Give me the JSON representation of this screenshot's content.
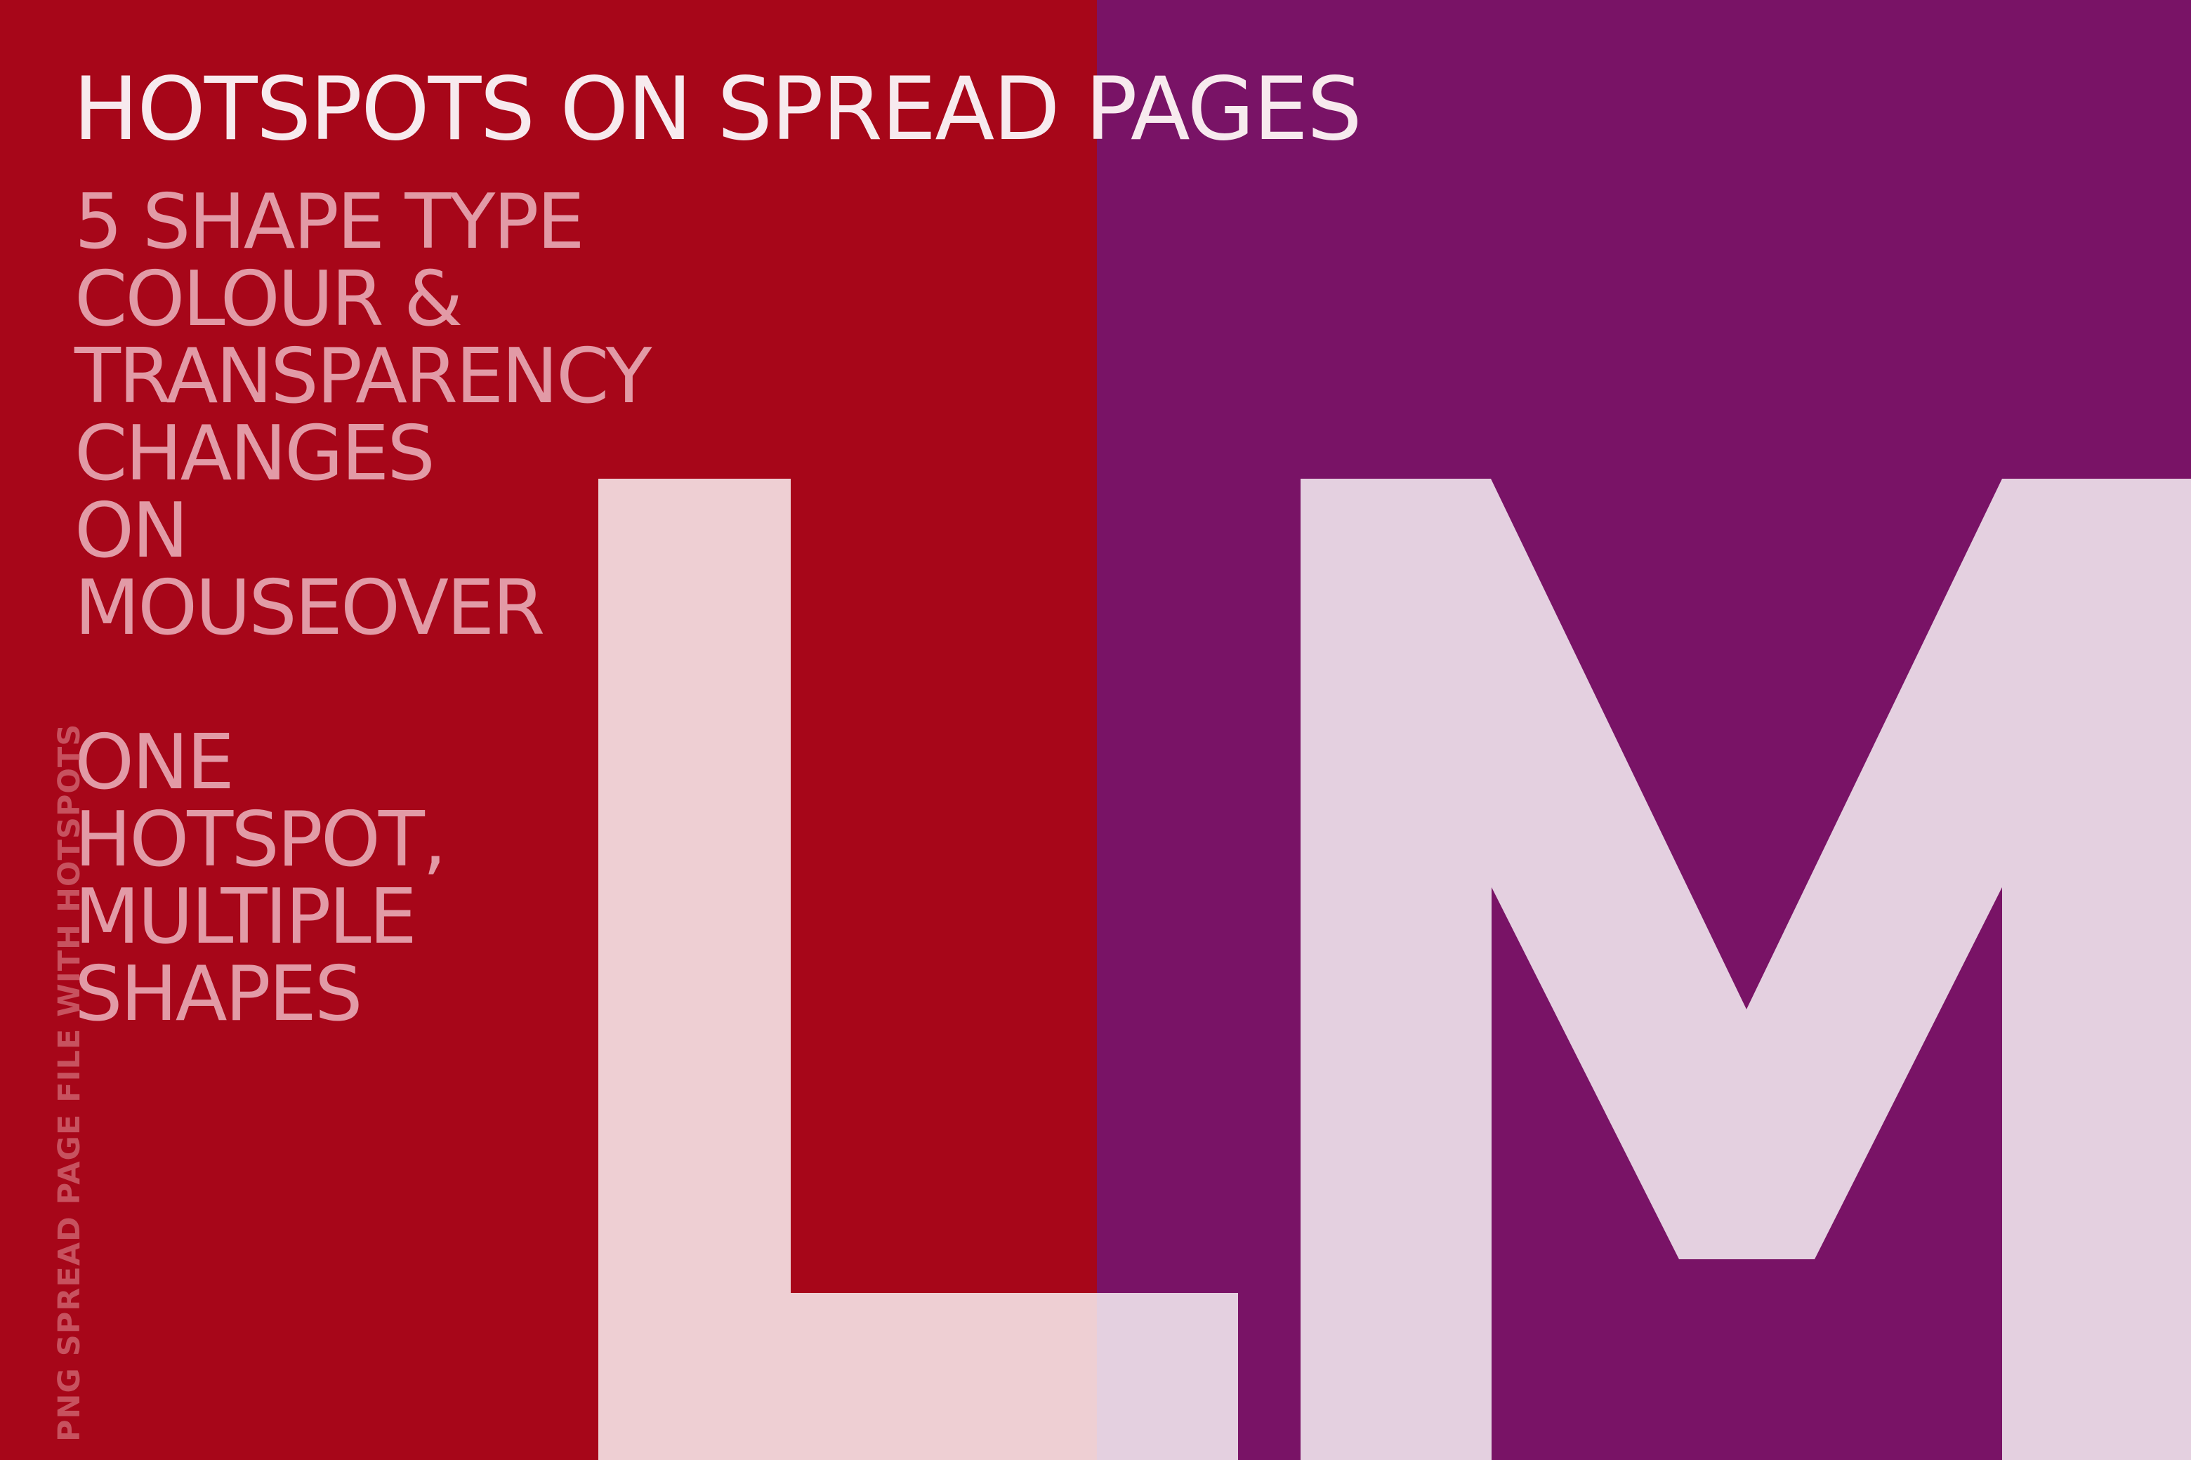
{
  "title": "HOTSPOTS ON SPREAD PAGES",
  "features": [
    "5 SHAPE TYPE",
    "COLOUR &",
    "TRANSPARENCY",
    "CHANGES",
    "ON",
    "MOUSEOVER",
    "ONE",
    "HOTSPOT,",
    "MULTIPLE",
    "SHAPES"
  ],
  "side_note": "PNG SPREAD PAGE FILE WITH HOTSPOTS",
  "letters": {
    "left": "L",
    "right": "M"
  },
  "colors": {
    "left_page": "#a70619",
    "right_page": "#791366",
    "letter_left": "#eecfd3",
    "letter_right": "#e4d0e0",
    "title_text": "#f7eaee",
    "body_text": "#e29aa6",
    "side_note_text": "#c7525f"
  }
}
